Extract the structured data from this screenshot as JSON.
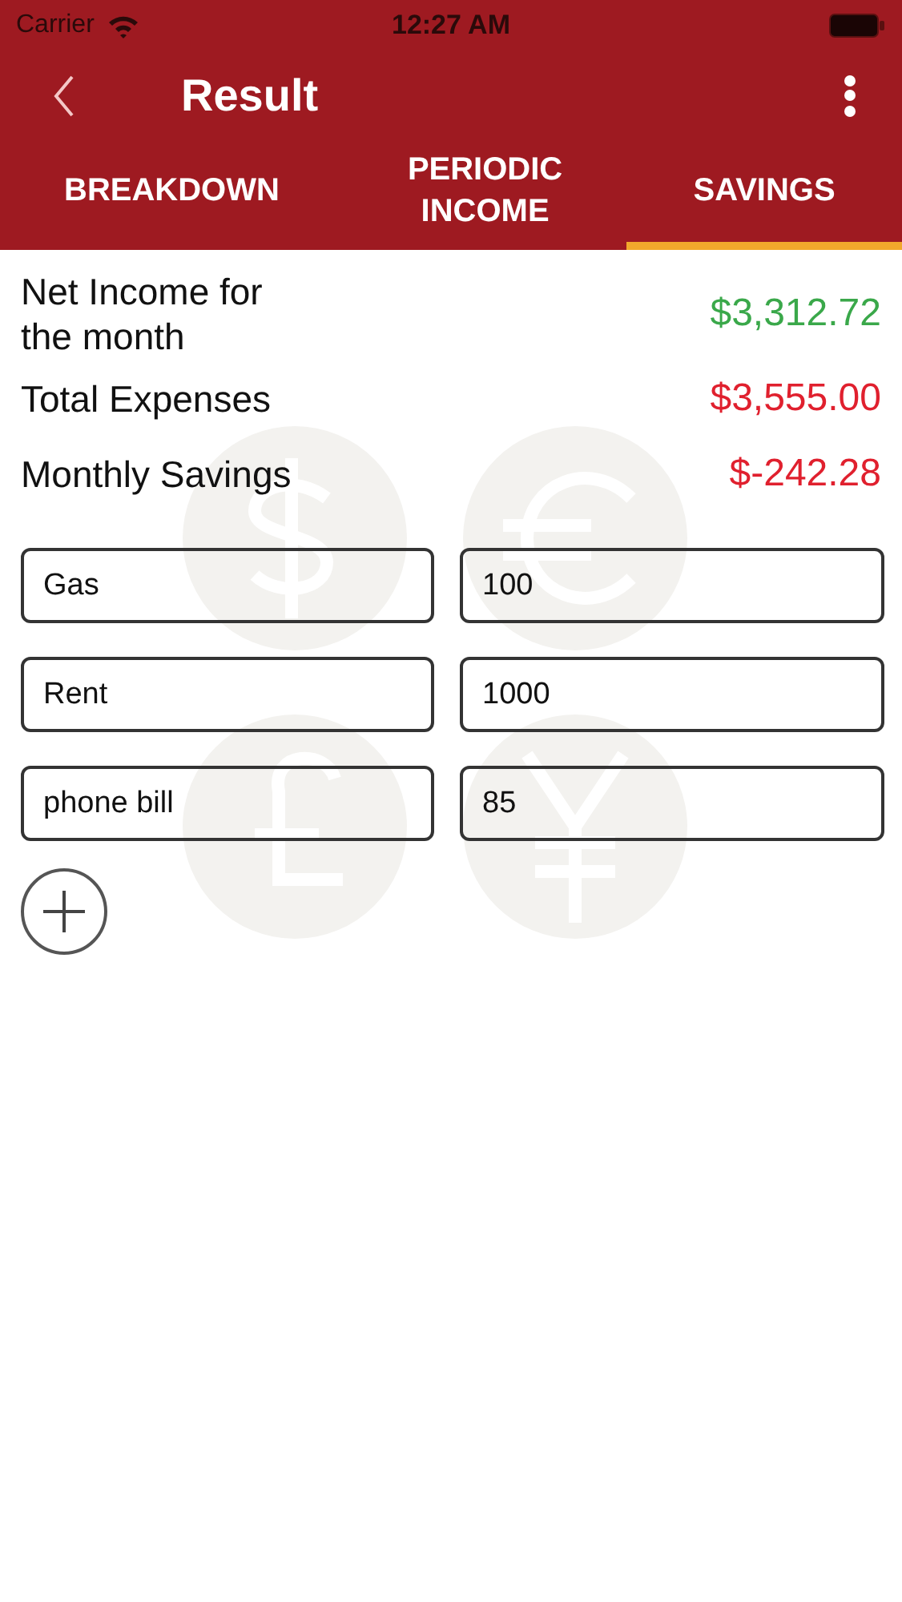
{
  "status_bar": {
    "carrier": "Carrier",
    "time": "12:27 AM"
  },
  "nav": {
    "title": "Result"
  },
  "tabs": [
    {
      "label": "BREAKDOWN",
      "selected": false
    },
    {
      "label": "PERIODIC INCOME",
      "selected": false
    },
    {
      "label": "SAVINGS",
      "selected": true
    }
  ],
  "summary": [
    {
      "label": "Net Income for the month",
      "value": "$3,312.72",
      "color": "#3aa84a"
    },
    {
      "label": "Total Expenses",
      "value": "$3,555.00",
      "color": "#e0202e"
    },
    {
      "label": "Monthly Savings",
      "value": "$-242.28",
      "color": "#e0202e"
    }
  ],
  "expenses": [
    {
      "name": "Gas",
      "amount": "100"
    },
    {
      "name": "Rent",
      "amount": "1000"
    },
    {
      "name": "phone bill",
      "amount": "85"
    }
  ]
}
